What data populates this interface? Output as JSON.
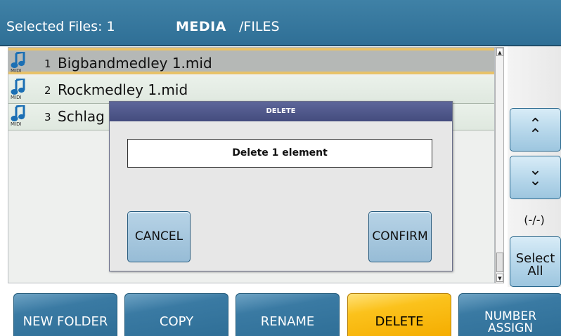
{
  "header": {
    "selected_label": "Selected Files:  1",
    "section": "MEDIA",
    "path": "/FILES"
  },
  "files": [
    {
      "num": "1",
      "name": "Bigbandmedley 1.mid",
      "icon": "midi-file-icon",
      "tag": "MIDI",
      "selected": true
    },
    {
      "num": "2",
      "name": "Rockmedley 1.mid",
      "icon": "midi-file-icon",
      "tag": "MIDI",
      "selected": false
    },
    {
      "num": "3",
      "name": "Schlag",
      "icon": "midi-file-icon",
      "tag": "MIDI",
      "selected": false
    }
  ],
  "side": {
    "up_label": "^\n^",
    "down_label": "v\nv",
    "page_indicator": "(-/-)",
    "select_all_label": "Select\nAll"
  },
  "dialog": {
    "title": "DELETE",
    "message": "Delete 1 element",
    "cancel_label": "CANCEL",
    "confirm_label": "CONFIRM"
  },
  "toolbar": {
    "new_folder": "NEW FOLDER",
    "copy": "COPY",
    "rename": "RENAME",
    "delete": "DELETE",
    "number_assign": "NUMBER\nASSIGN"
  },
  "colors": {
    "header": "#3a7aa3",
    "accent_active": "#f9b90d",
    "selection_border": "#e8c26a",
    "dialog_title": "#4f5889"
  }
}
